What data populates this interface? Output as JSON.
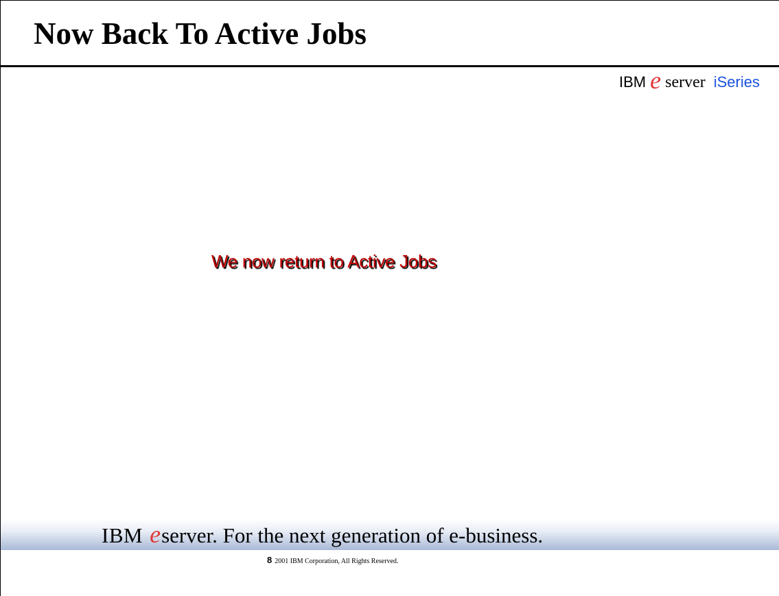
{
  "slide": {
    "title": "Now Back To Active Jobs",
    "brand": {
      "ibm": "IBM",
      "e_glyph": "e",
      "server": "server",
      "series": "iSeries"
    },
    "message": "We now return to Active Jobs",
    "footer": {
      "ibm": "IBM",
      "e_glyph": "e",
      "tagline_rest": "server.  For the next generation of e-business.",
      "copyright_number": "8",
      "copyright_text": "2001 IBM Corporation, All Rights Reserved."
    }
  },
  "colors": {
    "title": "#000000",
    "message": "#c00000",
    "e_logo": "#e0393b",
    "series": "#1a52e0",
    "footer_gradient_end": "#a9b9d6"
  },
  "icons": [
    "eserver-e-logo-icon",
    "footer-eserver-e-logo-icon"
  ]
}
